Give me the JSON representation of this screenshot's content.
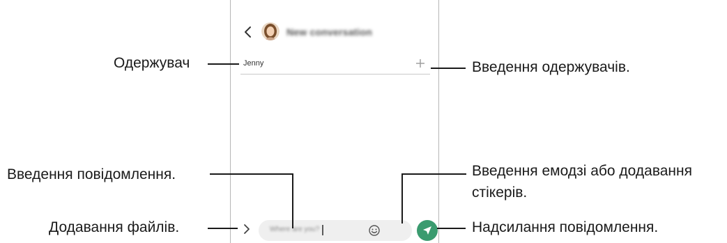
{
  "screen": {
    "title": "New conversation",
    "recipient": "Jenny",
    "message_placeholder": "Where are you?",
    "accent_color": "#3a9b6f",
    "icons": [
      "back-arrow-icon",
      "contact-avatar",
      "add-recipient-icon",
      "attach-chevron-icon",
      "emoji-icon",
      "send-icon"
    ]
  },
  "callouts": {
    "recipient": "Одержувач",
    "enter_recipients": "Введення одержувачів.",
    "enter_message": "Введення повідомлення.",
    "emoji_stickers": "Введення емодзі або додавання стікерів.",
    "attach_files": "Додавання файлів.",
    "send_message": "Надсилання повідомлення."
  }
}
